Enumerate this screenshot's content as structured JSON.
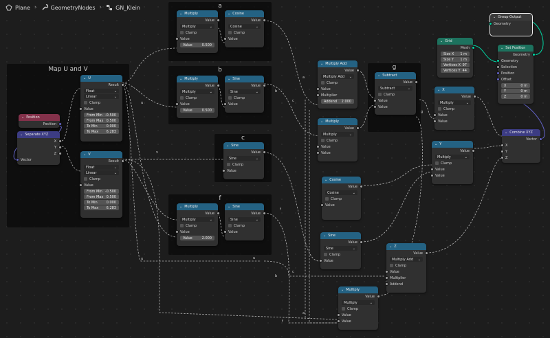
{
  "breadcrumb": {
    "items": [
      "Plane",
      "GeometryNodes",
      "GN_Klein"
    ]
  },
  "frames": {
    "a": "a",
    "b": "b",
    "c": "c",
    "f": "f",
    "g": "g",
    "uv": "Map U and V"
  },
  "common": {
    "value": "Value",
    "clamp": "Clamp",
    "result": "Result",
    "multiply": "Multiply",
    "sine": "Sine",
    "cosine": "Cosine",
    "vector": "Vector",
    "geometry": "Geometry"
  },
  "position": {
    "title": "Position",
    "out": "Position"
  },
  "separate": {
    "title": "Separate XYZ",
    "x": "X",
    "y": "Y",
    "z": "Z",
    "vector": "Vector"
  },
  "mapU": {
    "title": "U",
    "data_type": "Float",
    "interp": "Linear",
    "from_min_label": "From Min",
    "from_min": "-0.500",
    "from_max_label": "From Max",
    "from_max": "0.500",
    "to_min_label": "To Min",
    "to_min": "0.000",
    "to_max_label": "To Max",
    "to_max": "6.283"
  },
  "mapV": {
    "title": "V",
    "data_type": "Float",
    "interp": "Linear",
    "from_min_label": "From Min",
    "from_min": "-0.500",
    "from_max_label": "From Max",
    "from_max": "0.500",
    "to_min_label": "To Min",
    "to_min": "0.000",
    "to_max_label": "To Max",
    "to_max": "6.283"
  },
  "mulA": {
    "value": "0.500"
  },
  "mulB": {
    "value": "0.500"
  },
  "mulF": {
    "value": "2.000"
  },
  "muladd": {
    "title": "Multiply Add",
    "op": "Multiply Add",
    "multiplier": "Multiplier",
    "addend_label": "Addend",
    "addend": "2.000"
  },
  "subtract": {
    "title": "Subtract",
    "op": "Subtract"
  },
  "grid": {
    "title": "Grid",
    "mesh": "Mesh",
    "size_x_label": "Size X",
    "size_x": "1 m",
    "size_y_label": "Size Y",
    "size_y": "1 m",
    "verts_x_label": "Vertices X",
    "verts_x": "97",
    "verts_y_label": "Vertices Y",
    "verts_y": "44"
  },
  "groupOutput": {
    "title": "Group Output",
    "geometry": "Geometry"
  },
  "setPosition": {
    "title": "Set Position",
    "geometry": "Geometry",
    "selection": "Selection",
    "position": "Position",
    "offset": "Offset",
    "x_label": "X",
    "x": "0 m",
    "y_label": "Y",
    "y": "0 m",
    "z_label": "Z",
    "z": "0 m"
  },
  "nodeX": {
    "title": "X"
  },
  "nodeY": {
    "title": "Y"
  },
  "nodeZ": {
    "title": "Z",
    "op": "Multiply Add",
    "multiplier": "Multiplier",
    "addend": "Addend"
  },
  "combine": {
    "title": "Combine XYZ",
    "vector": "Vector",
    "x": "X",
    "y": "Y",
    "z": "Z"
  },
  "reroute_labels": {
    "u": "u",
    "v": "v",
    "a": "a",
    "b": "b",
    "c": "c",
    "f": "f",
    "g": "g"
  }
}
